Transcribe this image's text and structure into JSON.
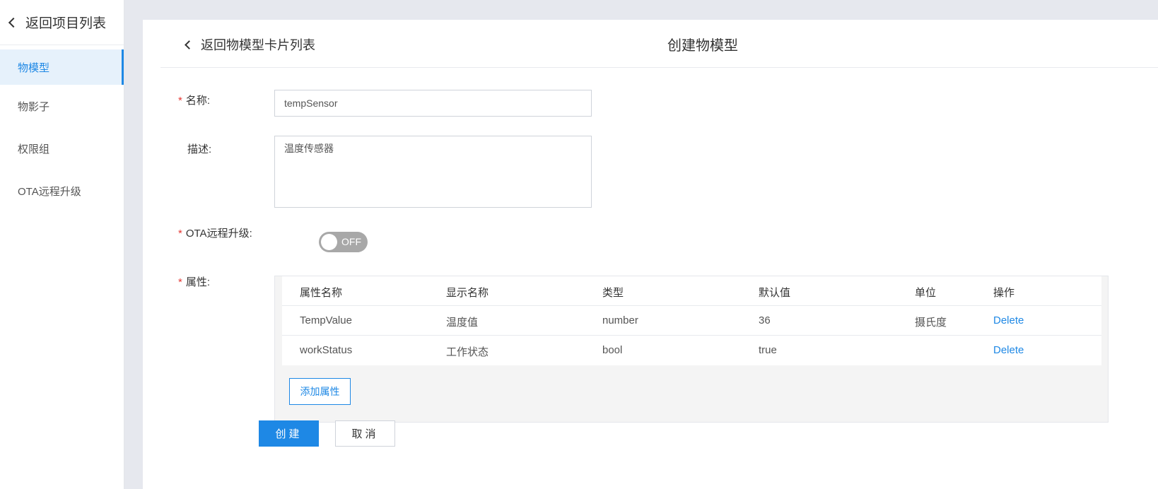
{
  "sidebar": {
    "back_label": "返回项目列表",
    "items": [
      {
        "label": "物模型",
        "active": true
      },
      {
        "label": "物影子"
      },
      {
        "label": "权限组"
      },
      {
        "label": "OTA远程升级"
      }
    ]
  },
  "header": {
    "back_label": "返回物模型卡片列表",
    "title": "创建物模型"
  },
  "form": {
    "name_label": "名称:",
    "name_value": "tempSensor",
    "desc_label": "描述:",
    "desc_value": "温度传感器",
    "ota_label": "OTA远程升级:",
    "ota_toggle": "OFF",
    "props_label": "属性:",
    "required_mark": "*"
  },
  "props_table": {
    "columns": [
      "属性名称",
      "显示名称",
      "类型",
      "默认值",
      "单位",
      "操作"
    ],
    "rows": [
      {
        "name": "TempValue",
        "display": "温度值",
        "type": "number",
        "default": "36",
        "unit": "摄氏度",
        "action": "Delete"
      },
      {
        "name": "workStatus",
        "display": "工作状态",
        "type": "bool",
        "default": "true",
        "unit": "",
        "action": "Delete"
      }
    ],
    "add_label": "添加属性"
  },
  "actions": {
    "create_label": "创建",
    "cancel_label": "取消"
  },
  "colors": {
    "accent": "#1e88e5",
    "required": "#e53935",
    "toggle_off": "#a8a8a8"
  }
}
